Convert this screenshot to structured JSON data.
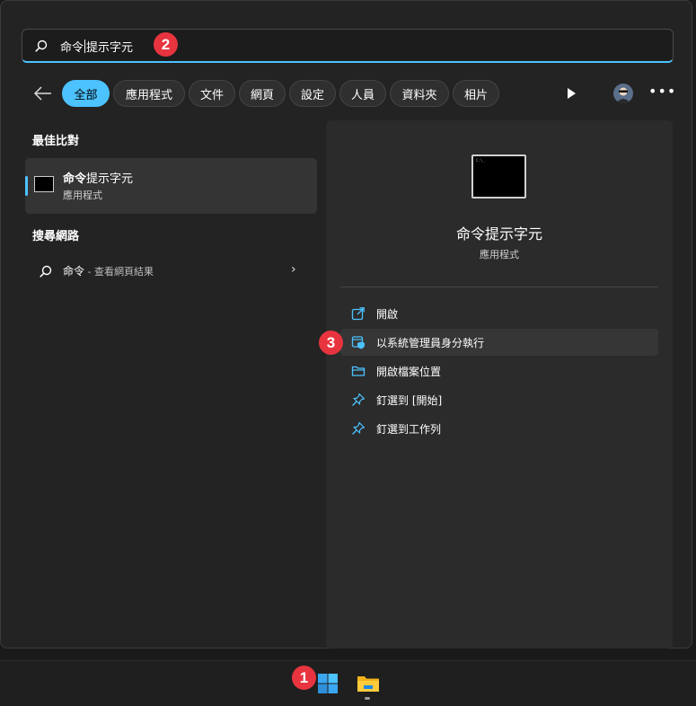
{
  "search": {
    "before_caret": "命令",
    "after_caret": "提示字元"
  },
  "annotations": {
    "n1": "1",
    "n2": "2",
    "n3": "3"
  },
  "filters": [
    {
      "label": "全部",
      "active": true
    },
    {
      "label": "應用程式"
    },
    {
      "label": "文件"
    },
    {
      "label": "網頁"
    },
    {
      "label": "設定"
    },
    {
      "label": "人員"
    },
    {
      "label": "資料夾"
    },
    {
      "label": "相片"
    }
  ],
  "best_match": {
    "heading": "最佳比對",
    "title_bold": "命令",
    "title_rest": "提示字元",
    "subtitle": "應用程式"
  },
  "web": {
    "heading": "搜尋網路",
    "query": "命令",
    "suffix": " - 查看網頁結果"
  },
  "details": {
    "title": "命令提示字元",
    "type": "應用程式",
    "actions": [
      {
        "label": "開啟",
        "icon": "open-icon"
      },
      {
        "label": "以系統管理員身分執行",
        "icon": "shield-icon"
      },
      {
        "label": "開啟檔案位置",
        "icon": "folder-icon"
      },
      {
        "label": "釘選到 [開始]",
        "icon": "pin-icon"
      },
      {
        "label": "釘選到工作列",
        "icon": "pin-icon"
      }
    ]
  },
  "colors": {
    "accent": "#4cc2ff",
    "badge": "#e8343f"
  }
}
